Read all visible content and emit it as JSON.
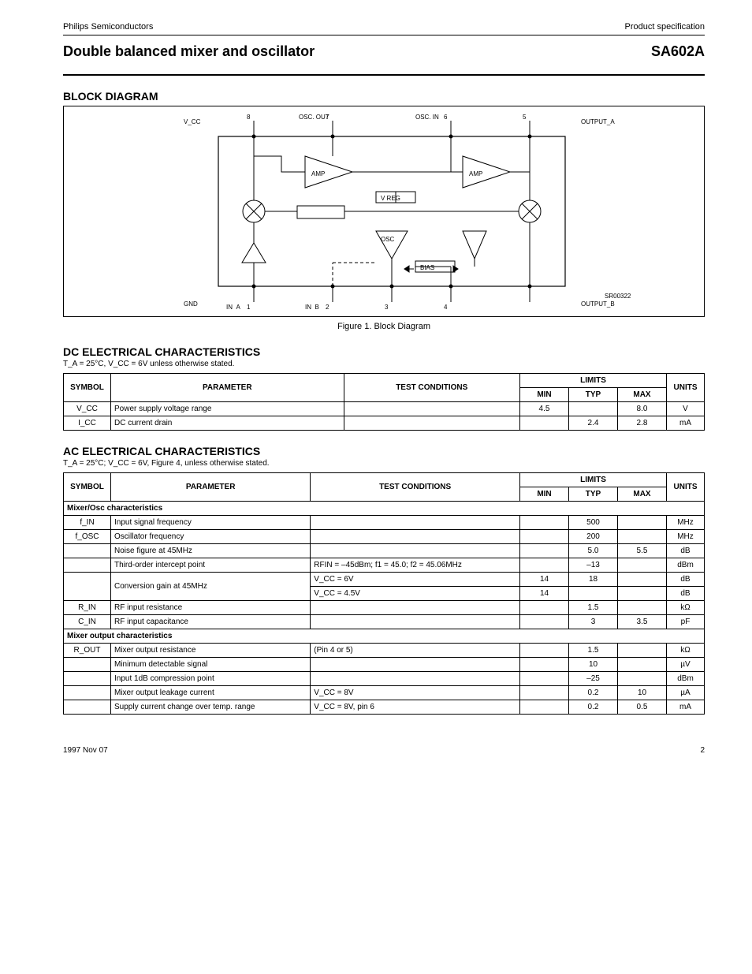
{
  "header": {
    "company": "Philips Semiconductors",
    "doc_type": "Product specification",
    "title_left": "Double balanced mixer and oscillator",
    "title_right": "SA602A"
  },
  "block_diagram": {
    "heading": "BLOCK DIAGRAM",
    "caption": "Figure 1.  Block Diagram",
    "code": "SR00322",
    "pins_top": [
      "1",
      "2",
      "3",
      "4"
    ],
    "pins_bottom": [
      "8",
      "7",
      "6",
      "5"
    ],
    "inputs": {
      "a": "IN_A",
      "b": "IN_B"
    },
    "outputs": {
      "a": "OUTPUT_A",
      "b": "OUTPUT_B"
    },
    "vcc": "V_CC",
    "gnd": "GND",
    "osc_in": "OSC. IN",
    "osc_out": "OSC. OUT",
    "blocks": {
      "amp": "AMP",
      "mixer": "MIXER",
      "osc": "OSC",
      "vreg": "V REG",
      "bias": "BIAS"
    }
  },
  "dc_section": {
    "heading": "DC ELECTRICAL CHARACTERISTICS",
    "conditions": "T_A = 25°C, V_CC = 6V unless otherwise stated.",
    "columns": {
      "symbol": "SYMBOL",
      "parameter": "PARAMETER",
      "test_conditions": "TEST CONDITIONS",
      "limits": "LIMITS",
      "limits_sub": [
        "MIN",
        "TYP",
        "MAX"
      ],
      "units": "UNITS"
    },
    "rows": [
      {
        "symbol": "V_CC",
        "parameter": "Power supply voltage range",
        "tc": "",
        "min": "4.5",
        "typ": "",
        "max": "8.0",
        "units": "V"
      },
      {
        "symbol": "I_CC",
        "parameter": "DC current drain",
        "tc": "",
        "min": "",
        "typ": "2.4",
        "max": "2.8",
        "units": "mA"
      }
    ]
  },
  "ac_section": {
    "heading": "AC ELECTRICAL CHARACTERISTICS",
    "conditions": "T_A = 25°C; V_CC = 6V, Figure 4, unless otherwise stated.",
    "columns": {
      "symbol": "SYMBOL",
      "parameter": "PARAMETER",
      "test_conditions": "TEST CONDITIONS",
      "limits": "LIMITS",
      "limits_sub": [
        "MIN",
        "TYP",
        "MAX"
      ],
      "units": "UNITS"
    },
    "sections": [
      {
        "title": "Mixer/Osc characteristics",
        "rows": [
          {
            "symbol": "f_IN",
            "parameter": "Input signal frequency",
            "tc": "",
            "min": "",
            "typ": "500",
            "max": "",
            "units": "MHz"
          },
          {
            "symbol": "f_OSC",
            "parameter": "Oscillator frequency",
            "tc": "",
            "min": "",
            "typ": "200",
            "max": "",
            "units": "MHz"
          },
          {
            "symbol": "",
            "parameter": "Noise figure at 45MHz",
            "tc": "",
            "min": "",
            "typ": "5.0",
            "max": "5.5",
            "units": "dB"
          },
          {
            "symbol": "",
            "parameter": "Third-order intercept point",
            "tc": "RFIN = –45dBm; f1 = 45.0;\nf2 = 45.06MHz",
            "min": "",
            "typ": "–13",
            "max": "",
            "units": "dBm"
          },
          {
            "symbol": "",
            "parameter": "Conversion gain at 45MHz",
            "tc": "V_CC = 6V",
            "min": "14",
            "typ": "18",
            "max": "",
            "units": "dB"
          },
          {
            "symbol": "",
            "parameter": "",
            "tc": "V_CC = 4.5V",
            "min": "14",
            "typ": "",
            "max": "",
            "units": "dB"
          },
          {
            "symbol": "R_IN",
            "parameter": "RF input resistance",
            "tc": "",
            "min": "",
            "typ": "1.5",
            "max": "",
            "units": "kΩ"
          },
          {
            "symbol": "C_IN",
            "parameter": "RF input capacitance",
            "tc": "",
            "min": "",
            "typ": "3",
            "max": "3.5",
            "units": "pF"
          }
        ]
      },
      {
        "title": "Mixer output characteristics",
        "rows": [
          {
            "symbol": "R_OUT",
            "parameter": "Mixer output resistance",
            "tc": "(Pin 4 or 5)",
            "min": "",
            "typ": "1.5",
            "max": "",
            "units": "kΩ"
          },
          {
            "symbol": "",
            "parameter": "Minimum detectable signal",
            "tc": "",
            "min": "",
            "typ": "10",
            "max": "",
            "units": "µV"
          },
          {
            "symbol": "",
            "parameter": "Input 1dB compression point",
            "tc": "",
            "min": "",
            "typ": "–25",
            "max": "",
            "units": "dBm"
          },
          {
            "symbol": "",
            "parameter": "Mixer output leakage current",
            "tc": "V_CC = 8V",
            "min": "",
            "typ": "0.2",
            "max": "10",
            "units": "µA"
          },
          {
            "symbol": "",
            "parameter": "Supply current change over temp. range",
            "tc": "V_CC = 8V, pin 6",
            "min": "",
            "typ": "0.2",
            "max": "0.5",
            "units": "mA"
          }
        ]
      }
    ]
  },
  "footer": {
    "date": "1997 Nov 07",
    "page": "2"
  }
}
